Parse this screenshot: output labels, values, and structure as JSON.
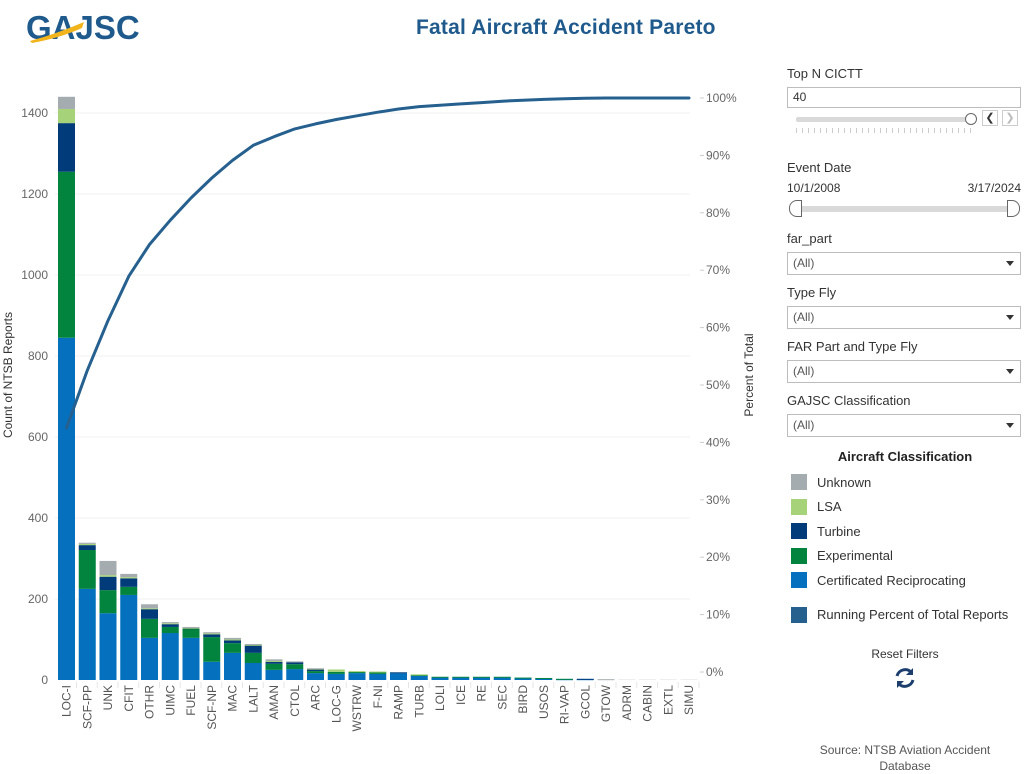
{
  "header": {
    "logo_text": "GAJSC",
    "title": "Fatal Aircraft Accident Pareto"
  },
  "filters": {
    "top_n": {
      "label": "Top N CICTT",
      "value": "40",
      "prev_icon": "chevron-left-icon",
      "next_icon": "chevron-right-icon"
    },
    "event_date": {
      "label": "Event Date",
      "start": "10/1/2008",
      "end": "3/17/2024"
    },
    "far_part": {
      "label": "far_part",
      "value": "(All)"
    },
    "type_fly": {
      "label": "Type Fly",
      "value": "(All)"
    },
    "far_part_type_fly": {
      "label": "FAR Part and Type Fly",
      "value": "(All)"
    },
    "gajsc_classification": {
      "label": "GAJSC Classification",
      "value": "(All)"
    }
  },
  "legend": {
    "title": "Aircraft Classification",
    "items": [
      {
        "label": "Unknown",
        "color": "#a5acaf"
      },
      {
        "label": "LSA",
        "color": "#a6d279"
      },
      {
        "label": "Turbine",
        "color": "#023b7a"
      },
      {
        "label": "Experimental",
        "color": "#03843e"
      },
      {
        "label": "Certificated Reciprocating",
        "color": "#0570bd"
      }
    ],
    "line_item": {
      "label": "Running Percent of Total Reports",
      "color": "#25608f"
    }
  },
  "reset": {
    "label": "Reset Filters",
    "icon": "refresh-icon"
  },
  "source": {
    "line1": "Source: NTSB Aviation Accident",
    "line2": "Database"
  },
  "chart_data": {
    "type": "bar",
    "stacked": true,
    "title": "Fatal Aircraft Accident Pareto",
    "xlabel": "",
    "ylabel": "Count of NTSB Reports",
    "y2label": "Percent of Total",
    "ylim": [
      0,
      1450
    ],
    "y_ticks": [
      0,
      200,
      400,
      600,
      800,
      1000,
      1200,
      1400
    ],
    "y2lim": [
      0,
      100
    ],
    "y2_ticks": [
      "0%",
      "10%",
      "20%",
      "30%",
      "40%",
      "50%",
      "60%",
      "70%",
      "80%",
      "90%",
      "100%"
    ],
    "grid": true,
    "categories": [
      "LOC-I",
      "SCF-PP",
      "UNK",
      "CFIT",
      "OTHR",
      "UIMC",
      "FUEL",
      "SCF-NP",
      "MAC",
      "LALT",
      "AMAN",
      "CTOL",
      "ARC",
      "LOC-G",
      "WSTRW",
      "F-NI",
      "RAMP",
      "TURB",
      "LOLI",
      "ICE",
      "RE",
      "SEC",
      "BIRD",
      "USOS",
      "RI-VAP",
      "GCOL",
      "GTOW",
      "ADRM",
      "CABIN",
      "EXTL",
      "SIMU"
    ],
    "series": [
      {
        "name": "Certificated Reciprocating",
        "color": "#0570bd",
        "values": [
          845,
          225,
          165,
          210,
          104,
          116,
          104,
          45,
          67,
          42,
          25,
          27,
          17,
          15,
          17,
          15,
          17,
          10,
          6,
          6,
          6,
          6,
          4,
          3,
          2,
          2,
          0,
          0,
          0,
          0,
          0
        ]
      },
      {
        "name": "Experimental",
        "color": "#03843e",
        "values": [
          410,
          96,
          57,
          20,
          47,
          15,
          22,
          61,
          24,
          25,
          15,
          12,
          5,
          5,
          3,
          5,
          0,
          3,
          2,
          2,
          2,
          2,
          2,
          2,
          1,
          0,
          0,
          0,
          0,
          0,
          0
        ]
      },
      {
        "name": "Turbine",
        "color": "#023b7a",
        "values": [
          120,
          12,
          33,
          21,
          24,
          7,
          2,
          7,
          8,
          19,
          5,
          5,
          5,
          0,
          0,
          0,
          2,
          0,
          0,
          0,
          0,
          0,
          0,
          0,
          0,
          1,
          0,
          0,
          0,
          0,
          0
        ]
      },
      {
        "name": "LSA",
        "color": "#a6d279",
        "values": [
          35,
          3,
          4,
          3,
          2,
          2,
          1,
          2,
          1,
          1,
          2,
          0,
          1,
          6,
          2,
          1,
          0,
          1,
          0,
          0,
          0,
          0,
          0,
          0,
          0,
          0,
          0,
          0,
          0,
          0,
          0
        ]
      },
      {
        "name": "Unknown",
        "color": "#a5acaf",
        "values": [
          30,
          3,
          35,
          8,
          10,
          3,
          2,
          3,
          4,
          2,
          4,
          2,
          1,
          0,
          0,
          0,
          0,
          0,
          0,
          0,
          0,
          0,
          0,
          0,
          0,
          0,
          2,
          0,
          0,
          0,
          0
        ]
      }
    ],
    "line": {
      "name": "Running Percent of Total Reports",
      "color": "#25608f",
      "axis": "right",
      "values": "cumulative percent of bar totals"
    }
  }
}
